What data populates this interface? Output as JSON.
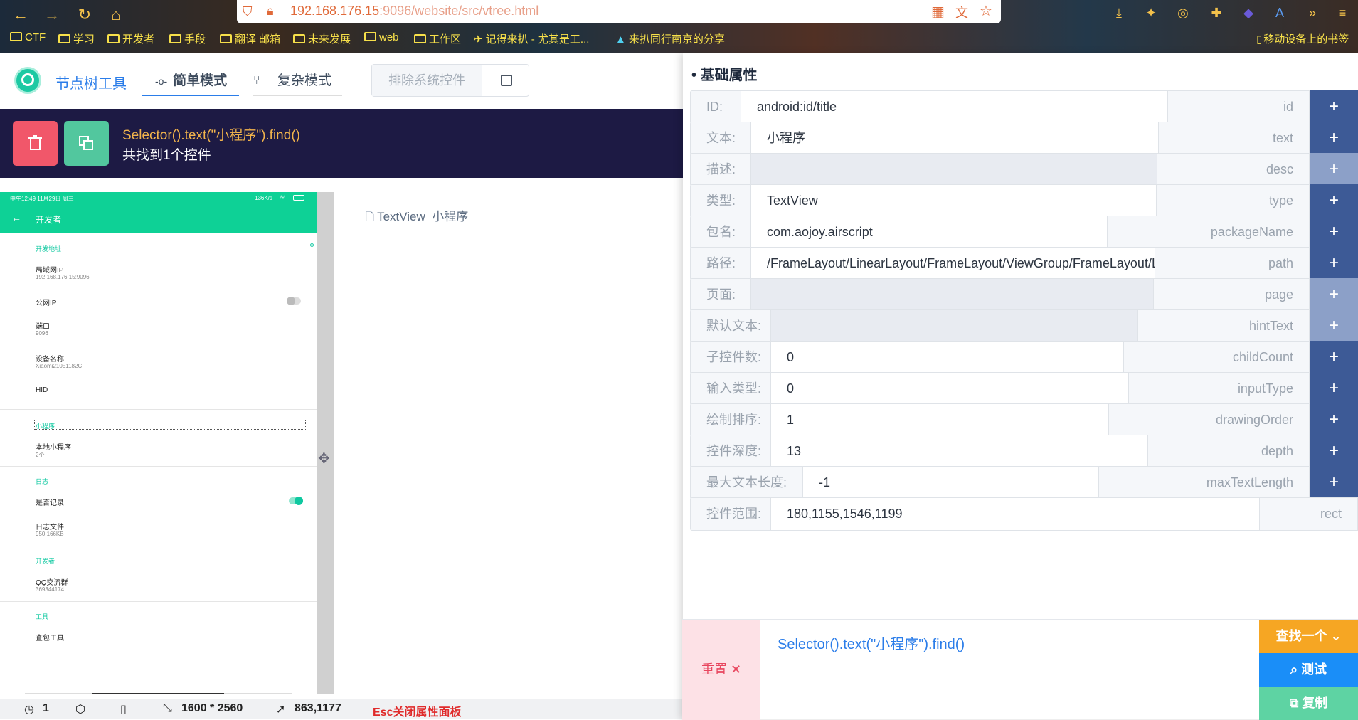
{
  "browser": {
    "url_host": "192.168.176.15",
    "url_rest": ":9096/website/src/vtree.html",
    "bookmarks": [
      "CTF",
      "学习",
      "开发者",
      "手段",
      "翻译 邮箱",
      "未来发展",
      "web",
      "工作区",
      "记得来扒 - 尤其是工...",
      "来扒同行南京的分享"
    ],
    "mobile_bookmarks": "移动设备上的书签"
  },
  "app": {
    "title": "节点树工具",
    "tab_simple": "简单模式",
    "tab_complex": "复杂模式",
    "exclude_label": "排除系统控件"
  },
  "selector_bar": {
    "selector": "Selector().text(\"小程序\").find()",
    "found": "共找到1个控件"
  },
  "phone": {
    "status_left": "中午12:49 11月29日 周三",
    "status_right": "136K/s",
    "header_title": "开发者",
    "sec_dev_addr": "开发地址",
    "lan_ip_label": "局域网IP",
    "lan_ip_value": "192.168.176.15:9096",
    "public_ip_label": "公网IP",
    "port_label": "端口",
    "port_value": "9096",
    "device_name_label": "设备名称",
    "device_name_value": "Xiaomi21051182C",
    "hid_label": "HID",
    "sec_mini": "小程序",
    "local_mini_label": "本地小程序",
    "local_mini_value": "2个",
    "sec_log": "日志",
    "log_record_label": "是否记录",
    "log_file_label": "日志文件",
    "log_file_value": "950.166KB",
    "sec_developer": "开发者",
    "qq_label": "QQ交流群",
    "qq_value": "369344174",
    "sec_tools": "工具",
    "capture_label": "查包工具"
  },
  "tree": {
    "node_type": "TextView",
    "node_text": "小程序"
  },
  "statusbar": {
    "count": "1",
    "resolution": "1600 * 2560",
    "cursor": "863,1177",
    "esc_hint": "Esc关闭属性面板"
  },
  "panel": {
    "title": "• 基础属性",
    "rows": [
      {
        "label": "ID:",
        "value": "android:id/title",
        "attr": "id"
      },
      {
        "label": "文本:",
        "value": "小程序",
        "attr": "text"
      },
      {
        "label": "描述:",
        "value": "",
        "attr": "desc"
      },
      {
        "label": "类型:",
        "value": "TextView",
        "attr": "type"
      },
      {
        "label": "包名:",
        "value": "com.aojoy.airscript",
        "attr": "packageName"
      },
      {
        "label": "路径:",
        "value": "/FrameLayout/LinearLayout/FrameLayout/ViewGroup/FrameLayout/LinearLayout",
        "attr": "path"
      },
      {
        "label": "页面:",
        "value": "",
        "attr": "page"
      },
      {
        "label": "默认文本:",
        "value": "",
        "attr": "hintText"
      },
      {
        "label": "子控件数:",
        "value": "0",
        "attr": "childCount"
      },
      {
        "label": "输入类型:",
        "value": "0",
        "attr": "inputType"
      },
      {
        "label": "绘制排序:",
        "value": "1",
        "attr": "drawingOrder"
      },
      {
        "label": "控件深度:",
        "value": "13",
        "attr": "depth"
      },
      {
        "label": "最大文本长度:",
        "value": "-1",
        "attr": "maxTextLength"
      },
      {
        "label": "控件范围:",
        "value": "180,1155,1546,1199",
        "attr": "rect"
      }
    ],
    "plus": "+"
  },
  "query": {
    "reset": "重置 ✕",
    "text": "Selector().text(\"小程序\").find()",
    "find_one": "查找一个 ⌄",
    "test": "测试",
    "copy": "复制"
  },
  "colors": {
    "accent": "#2b7de9",
    "dark_bar": "#1d1a44",
    "phone_green": "#0ed196",
    "plus_btn": "#3d5a96"
  }
}
